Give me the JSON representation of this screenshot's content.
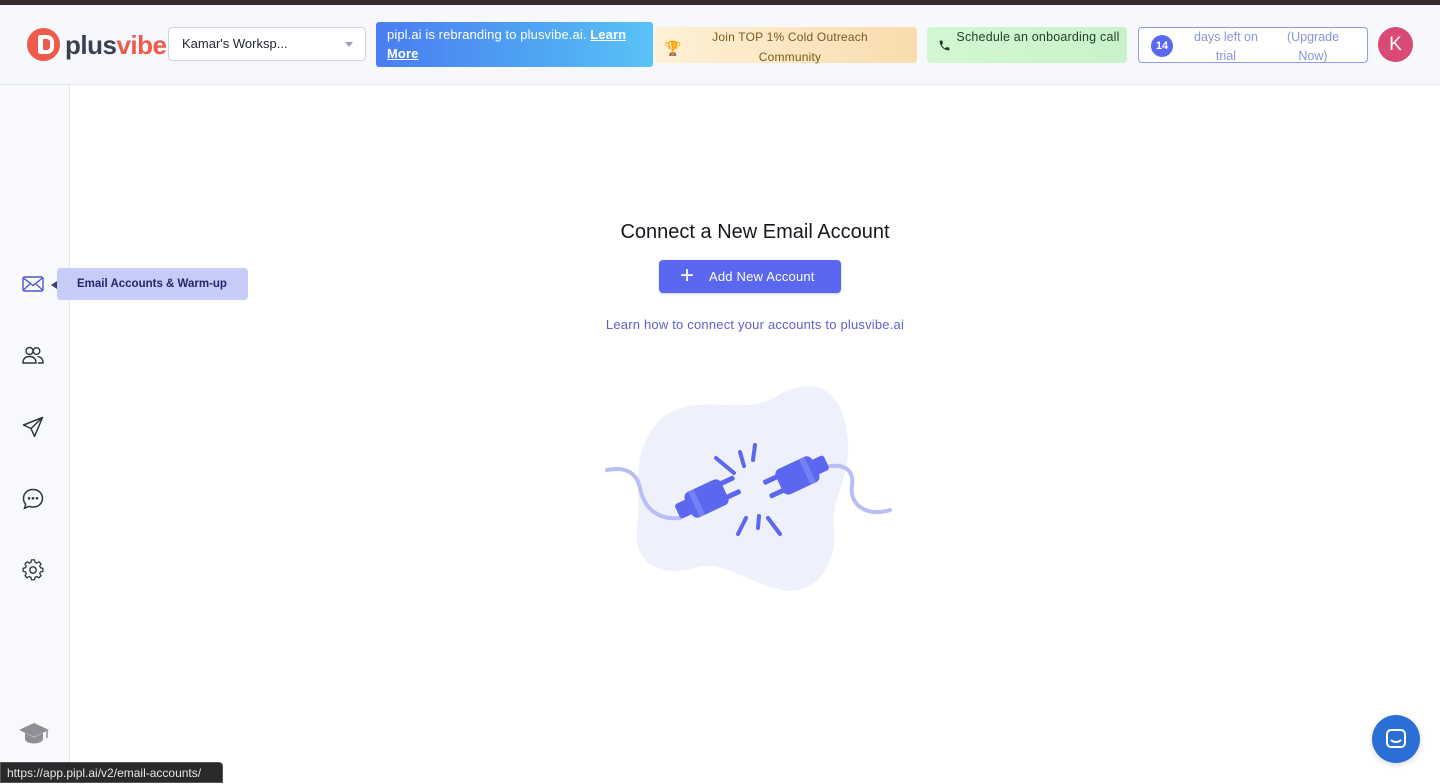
{
  "header": {
    "logo": {
      "part1": "plus",
      "part2": "vibe"
    },
    "workspace": {
      "name": "Kamar's Worksp..."
    },
    "rebrand": {
      "text": "pipl.ai is rebranding to plusvibe.ai. ",
      "link": "Learn More"
    },
    "community": {
      "text": "Join TOP 1% Cold Outreach Community",
      "icon": "trophy-icon"
    },
    "onboarding": {
      "text": "Schedule an onboarding call",
      "icon": "phone-icon"
    },
    "trial": {
      "days": "14",
      "text": "days left on trial",
      "upgrade": "(Upgrade Now)"
    },
    "avatar": {
      "initial": "K",
      "color": "#d94a76"
    }
  },
  "sidebar": {
    "items": [
      {
        "icon": "mail-icon",
        "tooltip": "Email Accounts & Warm-up"
      },
      {
        "icon": "users-icon"
      },
      {
        "icon": "send-icon"
      },
      {
        "icon": "chat-icon"
      },
      {
        "icon": "gear-icon"
      },
      {
        "icon": "graduation-cap-icon"
      }
    ]
  },
  "main": {
    "title": "Connect a New Email Account",
    "add_button": "Add New Account",
    "learn_link": "Learn how to connect your accounts to plusvibe.ai",
    "illustration": "unplugged-cable-illustration"
  },
  "statusbar": {
    "url": "https://app.pipl.ai/v2/email-accounts/"
  },
  "colors": {
    "accent": "#5a67ee",
    "brand": "#ee5a4c",
    "chat": "#2b6fd6"
  }
}
